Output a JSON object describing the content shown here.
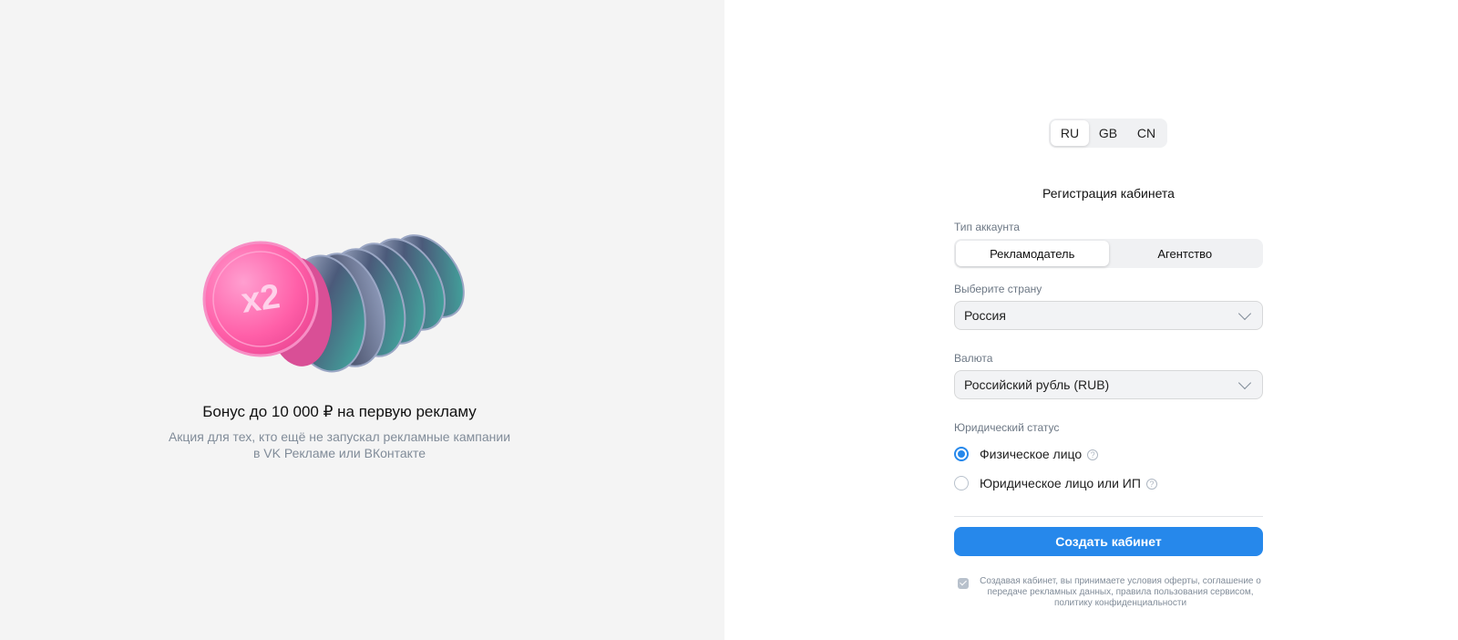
{
  "promo": {
    "badge_text": "x2",
    "title": "Бонус до 10 000 ₽ на первую рекламу",
    "subtitle_line1": "Акция для тех, кто ещё не запускал рекламные кампании",
    "subtitle_line2": "в VK Рекламе или ВКонтакте"
  },
  "lang_switch": {
    "items": [
      {
        "label": "RU",
        "active": true
      },
      {
        "label": "GB",
        "active": false
      },
      {
        "label": "CN",
        "active": false
      }
    ]
  },
  "form": {
    "title": "Регистрация кабинета",
    "account_type": {
      "label": "Тип аккаунта",
      "options": [
        {
          "label": "Рекламодатель",
          "selected": true
        },
        {
          "label": "Агентство",
          "selected": false
        }
      ]
    },
    "country": {
      "label": "Выберите страну",
      "value": "Россия"
    },
    "currency": {
      "label": "Валюта",
      "value": "Российский рубль (RUB)"
    },
    "legal_status": {
      "label": "Юридический статус",
      "options": [
        {
          "label": "Физическое лицо",
          "checked": true
        },
        {
          "label": "Юридическое лицо или ИП",
          "checked": false
        }
      ]
    },
    "submit_label": "Создать кабинет",
    "consent_text": "Создавая кабинет, вы принимаете условия оферты, соглашение о передаче рекламных данных, правила пользования сервисом, политику конфиденциальности"
  },
  "colors": {
    "accent": "#2688eb",
    "promo_bg": "#f4f4f4",
    "coin_pink": "#ff5fa8"
  },
  "icons": {
    "dropdown": "chevron-down-icon",
    "help": "question-icon",
    "consent": "checkbox-checked-icon"
  }
}
